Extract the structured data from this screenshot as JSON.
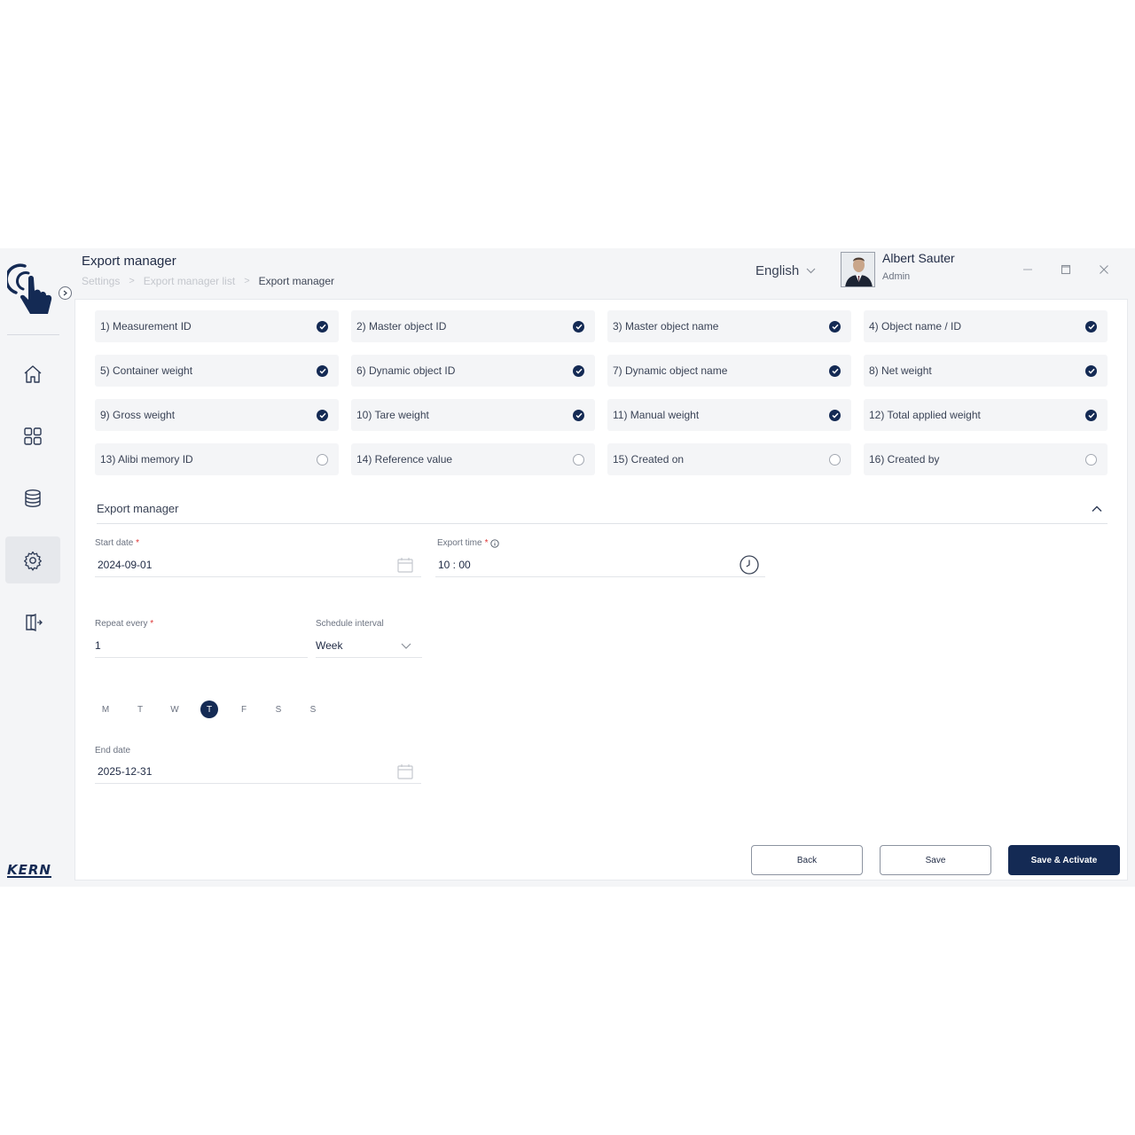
{
  "header": {
    "title": "Export manager",
    "breadcrumb": [
      "Settings",
      "Export manager list",
      "Export manager"
    ],
    "language": "English",
    "user_name": "Albert Sauter",
    "user_role": "Admin"
  },
  "sidebar": {
    "brand": "KERN",
    "items": [
      {
        "icon": "home-icon",
        "active": false
      },
      {
        "icon": "apps-grid-icon",
        "active": false
      },
      {
        "icon": "database-icon",
        "active": false
      },
      {
        "icon": "gear-icon",
        "active": true
      },
      {
        "icon": "logout-icon",
        "active": false
      }
    ]
  },
  "fields": [
    {
      "label": "1)  Measurement ID",
      "checked": true
    },
    {
      "label": "2)  Master object ID",
      "checked": true
    },
    {
      "label": "3)  Master object name",
      "checked": true
    },
    {
      "label": "4)  Object name / ID",
      "checked": true
    },
    {
      "label": "5)  Container weight",
      "checked": true
    },
    {
      "label": "6)  Dynamic object ID",
      "checked": true
    },
    {
      "label": "7)  Dynamic object name",
      "checked": true
    },
    {
      "label": "8)  Net weight",
      "checked": true
    },
    {
      "label": "9)  Gross weight",
      "checked": true
    },
    {
      "label": "10)  Tare weight",
      "checked": true
    },
    {
      "label": "11)  Manual weight",
      "checked": true
    },
    {
      "label": "12)  Total applied weight",
      "checked": true
    },
    {
      "label": "13)  Alibi memory ID",
      "checked": false
    },
    {
      "label": "14)  Reference value",
      "checked": false
    },
    {
      "label": "15)  Created on",
      "checked": false
    },
    {
      "label": "16)  Created by",
      "checked": false
    }
  ],
  "export_section": {
    "title": "Export manager",
    "start_date_label": "Start date",
    "start_date": "2024-09-01",
    "export_time_label": "Export time",
    "export_time": "10 : 00",
    "repeat_label": "Repeat every",
    "repeat_value": "1",
    "interval_label": "Schedule interval",
    "interval_value": "Week",
    "days": [
      {
        "label": "M",
        "active": false
      },
      {
        "label": "T",
        "active": false
      },
      {
        "label": "W",
        "active": false
      },
      {
        "label": "T",
        "active": true
      },
      {
        "label": "F",
        "active": false
      },
      {
        "label": "S",
        "active": false
      },
      {
        "label": "S",
        "active": false
      }
    ],
    "end_date_label": "End date",
    "end_date": "2025-12-31",
    "required_mark": "*"
  },
  "actions": {
    "back": "Back",
    "save": "Save",
    "save_activate": "Save & Activate"
  },
  "colors": {
    "primary": "#142a54",
    "chip_bg": "#f4f5f7",
    "required": "#dd3333"
  }
}
